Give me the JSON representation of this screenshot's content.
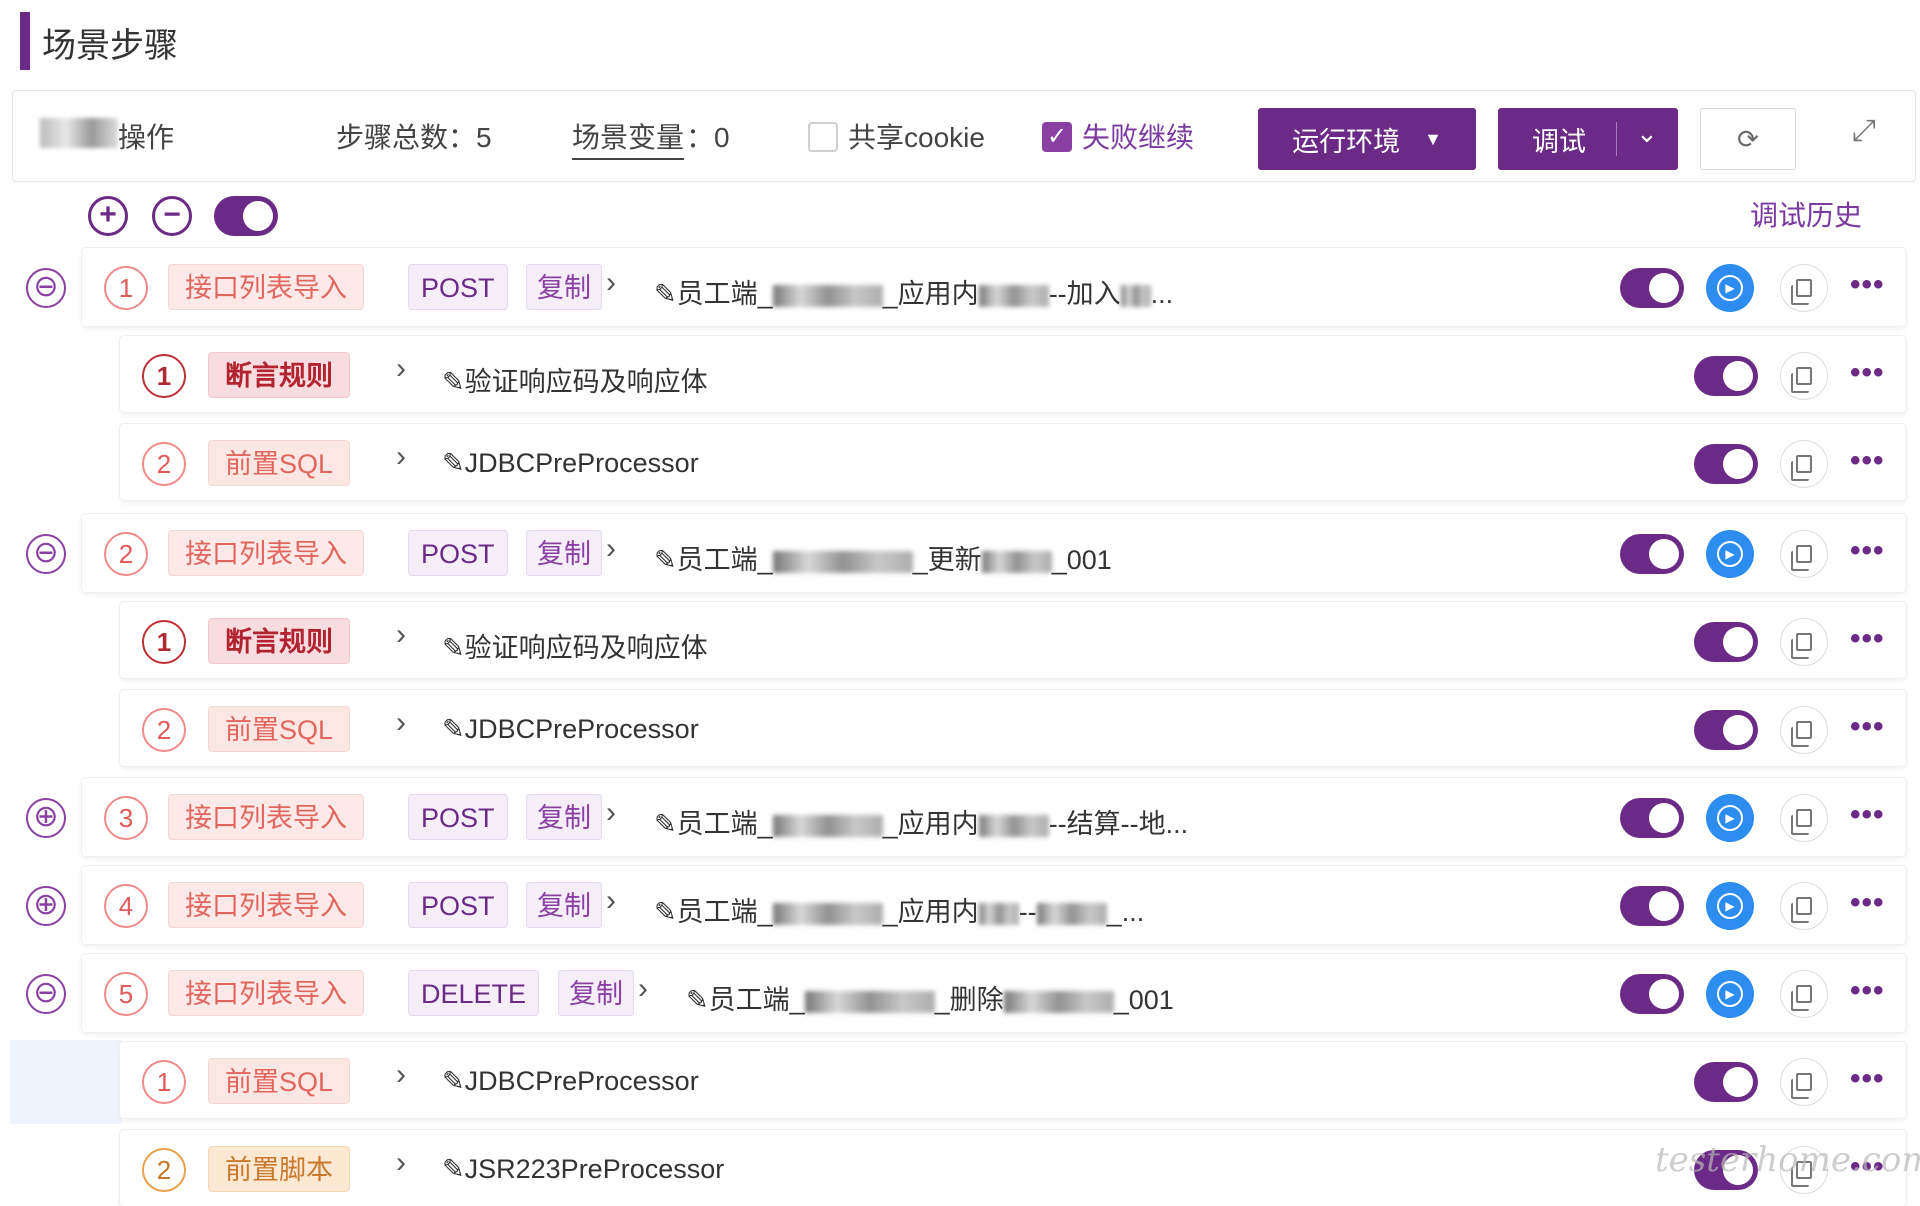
{
  "page": {
    "title": "场景步骤"
  },
  "toolbar": {
    "operation_label": "操作",
    "step_total_label": "步骤总数：5",
    "scene_variable_label": "场景变量",
    "scene_variable_value": "：0",
    "share_cookie_label": "共享cookie",
    "share_cookie_checked": false,
    "fail_continue_label": "失败继续",
    "fail_continue_checked": true,
    "run_env_label": "运行环境",
    "debug_label": "调试",
    "refresh_icon": "refresh-icon",
    "expand_icon": "expand-icon"
  },
  "controls": {
    "expand_all_icon": "plus-circle-icon",
    "collapse_all_icon": "minus-circle-icon",
    "toggle_on": true,
    "debug_history_label": "调试历史"
  },
  "colors": {
    "primary": "#6b2a86",
    "play": "#2d8cf0",
    "api_tag": "#e0665e",
    "assert_tag": "#b1232f",
    "script_tag": "#c9792b"
  },
  "steps": [
    {
      "index": "1",
      "side": "⊖",
      "type": "接口列表导入",
      "method": "POST",
      "copy": "复制",
      "name_a": "员工端_",
      "name_b": "_应用内",
      "name_c": "--加入",
      "name_d": "...",
      "children": [
        {
          "index": "1",
          "type": "断言规则",
          "name": "验证响应码及响应体"
        },
        {
          "index": "2",
          "type": "前置SQL",
          "name": "JDBCPreProcessor"
        }
      ]
    },
    {
      "index": "2",
      "side": "⊖",
      "type": "接口列表导入",
      "method": "POST",
      "copy": "复制",
      "name_a": "员工端_",
      "name_b": "_更新",
      "name_c": "_001",
      "name_d": "",
      "children": [
        {
          "index": "1",
          "type": "断言规则",
          "name": "验证响应码及响应体"
        },
        {
          "index": "2",
          "type": "前置SQL",
          "name": "JDBCPreProcessor"
        }
      ]
    },
    {
      "index": "3",
      "side": "⊕",
      "type": "接口列表导入",
      "method": "POST",
      "copy": "复制",
      "name_a": "员工端_",
      "name_b": "_应用内",
      "name_c": "--结算--地",
      "name_d": "..."
    },
    {
      "index": "4",
      "side": "⊕",
      "type": "接口列表导入",
      "method": "POST",
      "copy": "复制",
      "name_a": "员工端_",
      "name_b": "_应用内",
      "name_c": "--",
      "name_d": "_..."
    },
    {
      "index": "5",
      "side": "⊖",
      "type": "接口列表导入",
      "method": "DELETE",
      "copy": "复制",
      "name_a": "员工端_",
      "name_b": "_删除",
      "name_c": "_001",
      "name_d": "",
      "children": [
        {
          "index": "1",
          "type": "前置SQL",
          "name": "JDBCPreProcessor"
        },
        {
          "index": "2",
          "type": "前置脚本",
          "name": "JSR223PreProcessor"
        }
      ]
    }
  ],
  "watermark": "testerhome.com"
}
